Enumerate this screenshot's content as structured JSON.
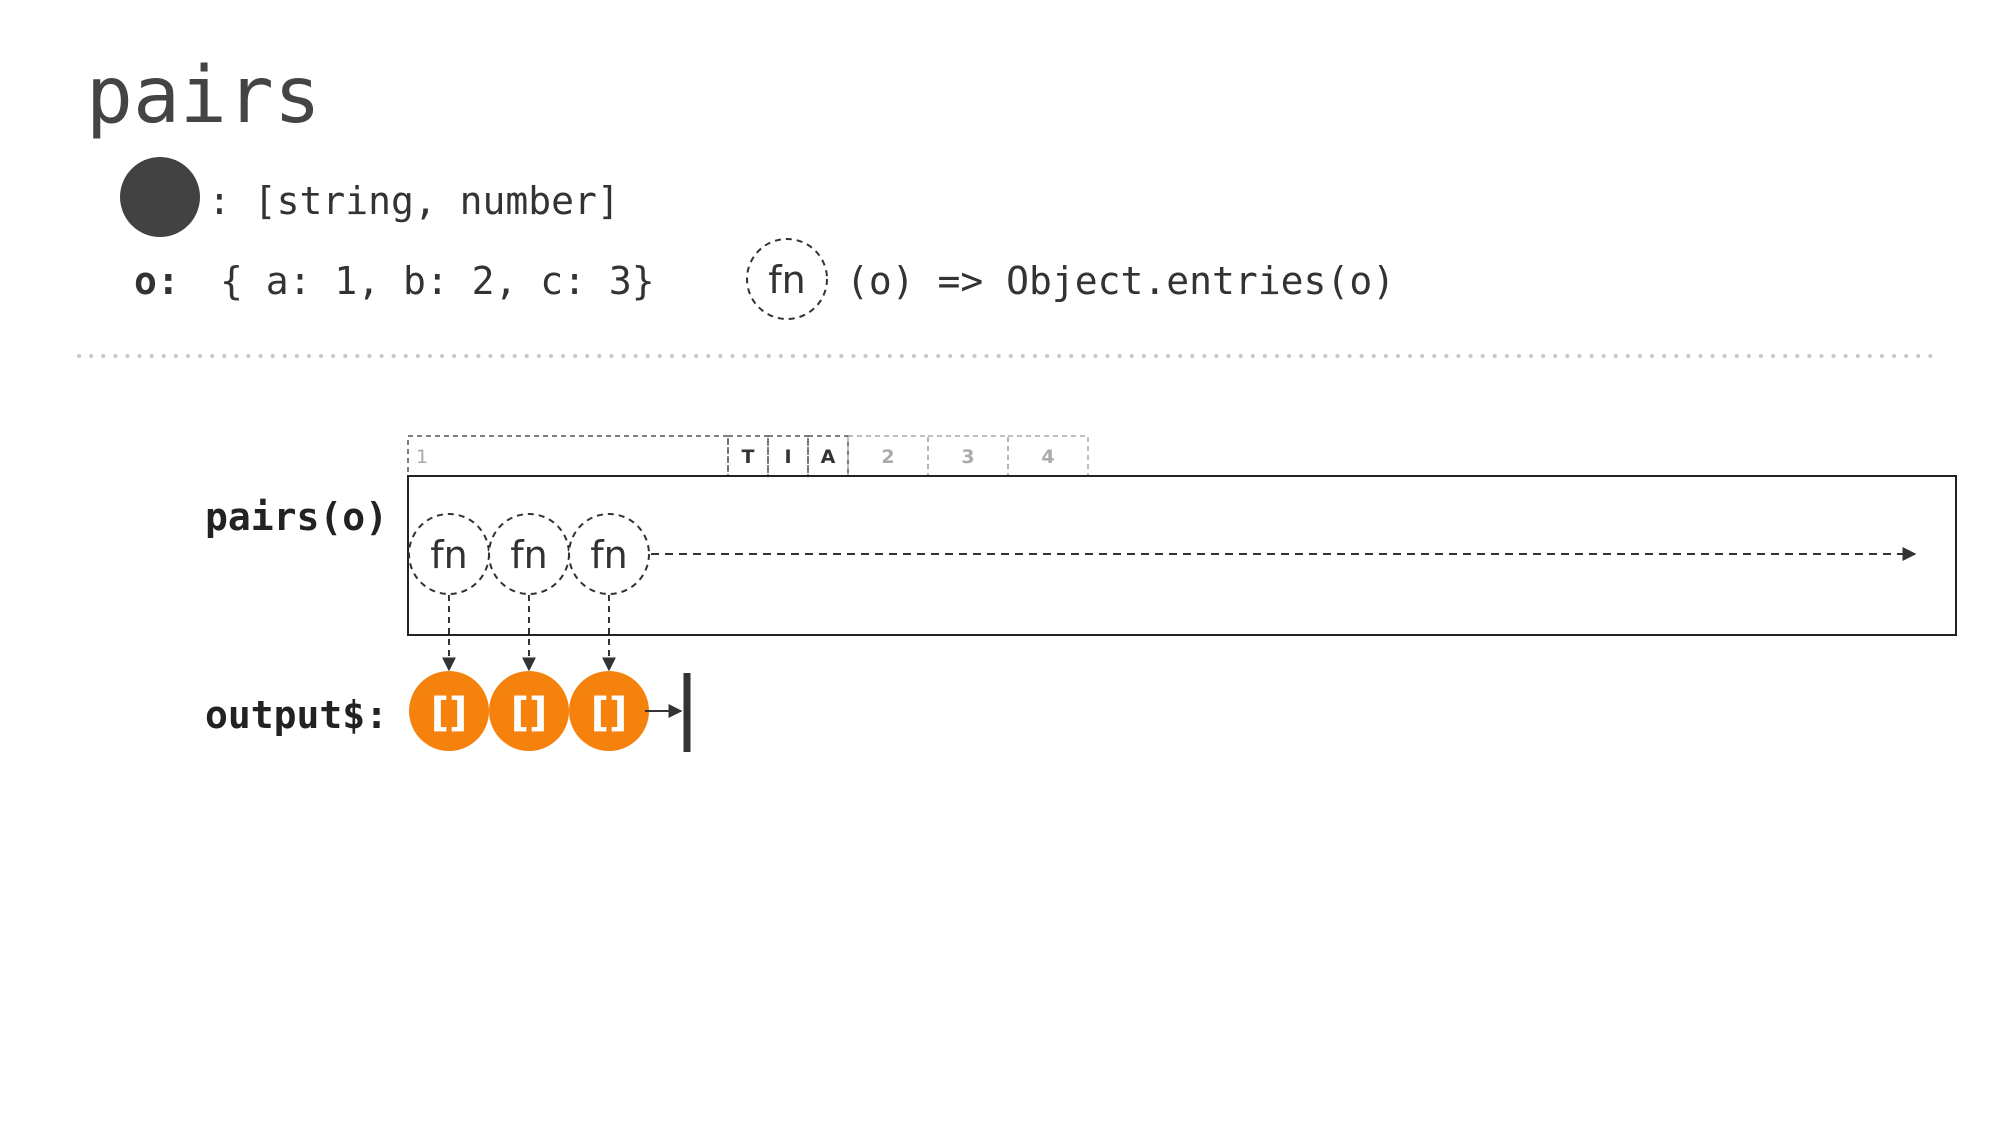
{
  "title": "pairs",
  "legend": {
    "type_text": ": [string, number]",
    "input_label": "o:",
    "input_value": "{ a: 1, b: 2, c: 3}",
    "fn_label": "fn",
    "fn_text": "(o) => Object.entries(o)"
  },
  "timeline": {
    "frames": [
      {
        "label": "1",
        "active": true
      },
      {
        "label": "T",
        "active": true
      },
      {
        "label": "I",
        "active": true
      },
      {
        "label": "A",
        "active": true
      },
      {
        "label": "2",
        "active": false
      },
      {
        "label": "3",
        "active": false
      },
      {
        "label": "4",
        "active": false
      }
    ]
  },
  "operator": {
    "label": "pairs(o)",
    "fn_label": "fn",
    "fn_count": 3
  },
  "output": {
    "label": "output$:",
    "emissions": [
      "[]",
      "[]",
      "[]"
    ],
    "completes": true
  },
  "colors": {
    "text": "#333333",
    "title": "#444444",
    "bullet": "#424242",
    "emission": "#f5820d",
    "emission_text": "#ffffff",
    "frame_inactive": "#aaaaaa",
    "separator": "#c8c8c8"
  }
}
